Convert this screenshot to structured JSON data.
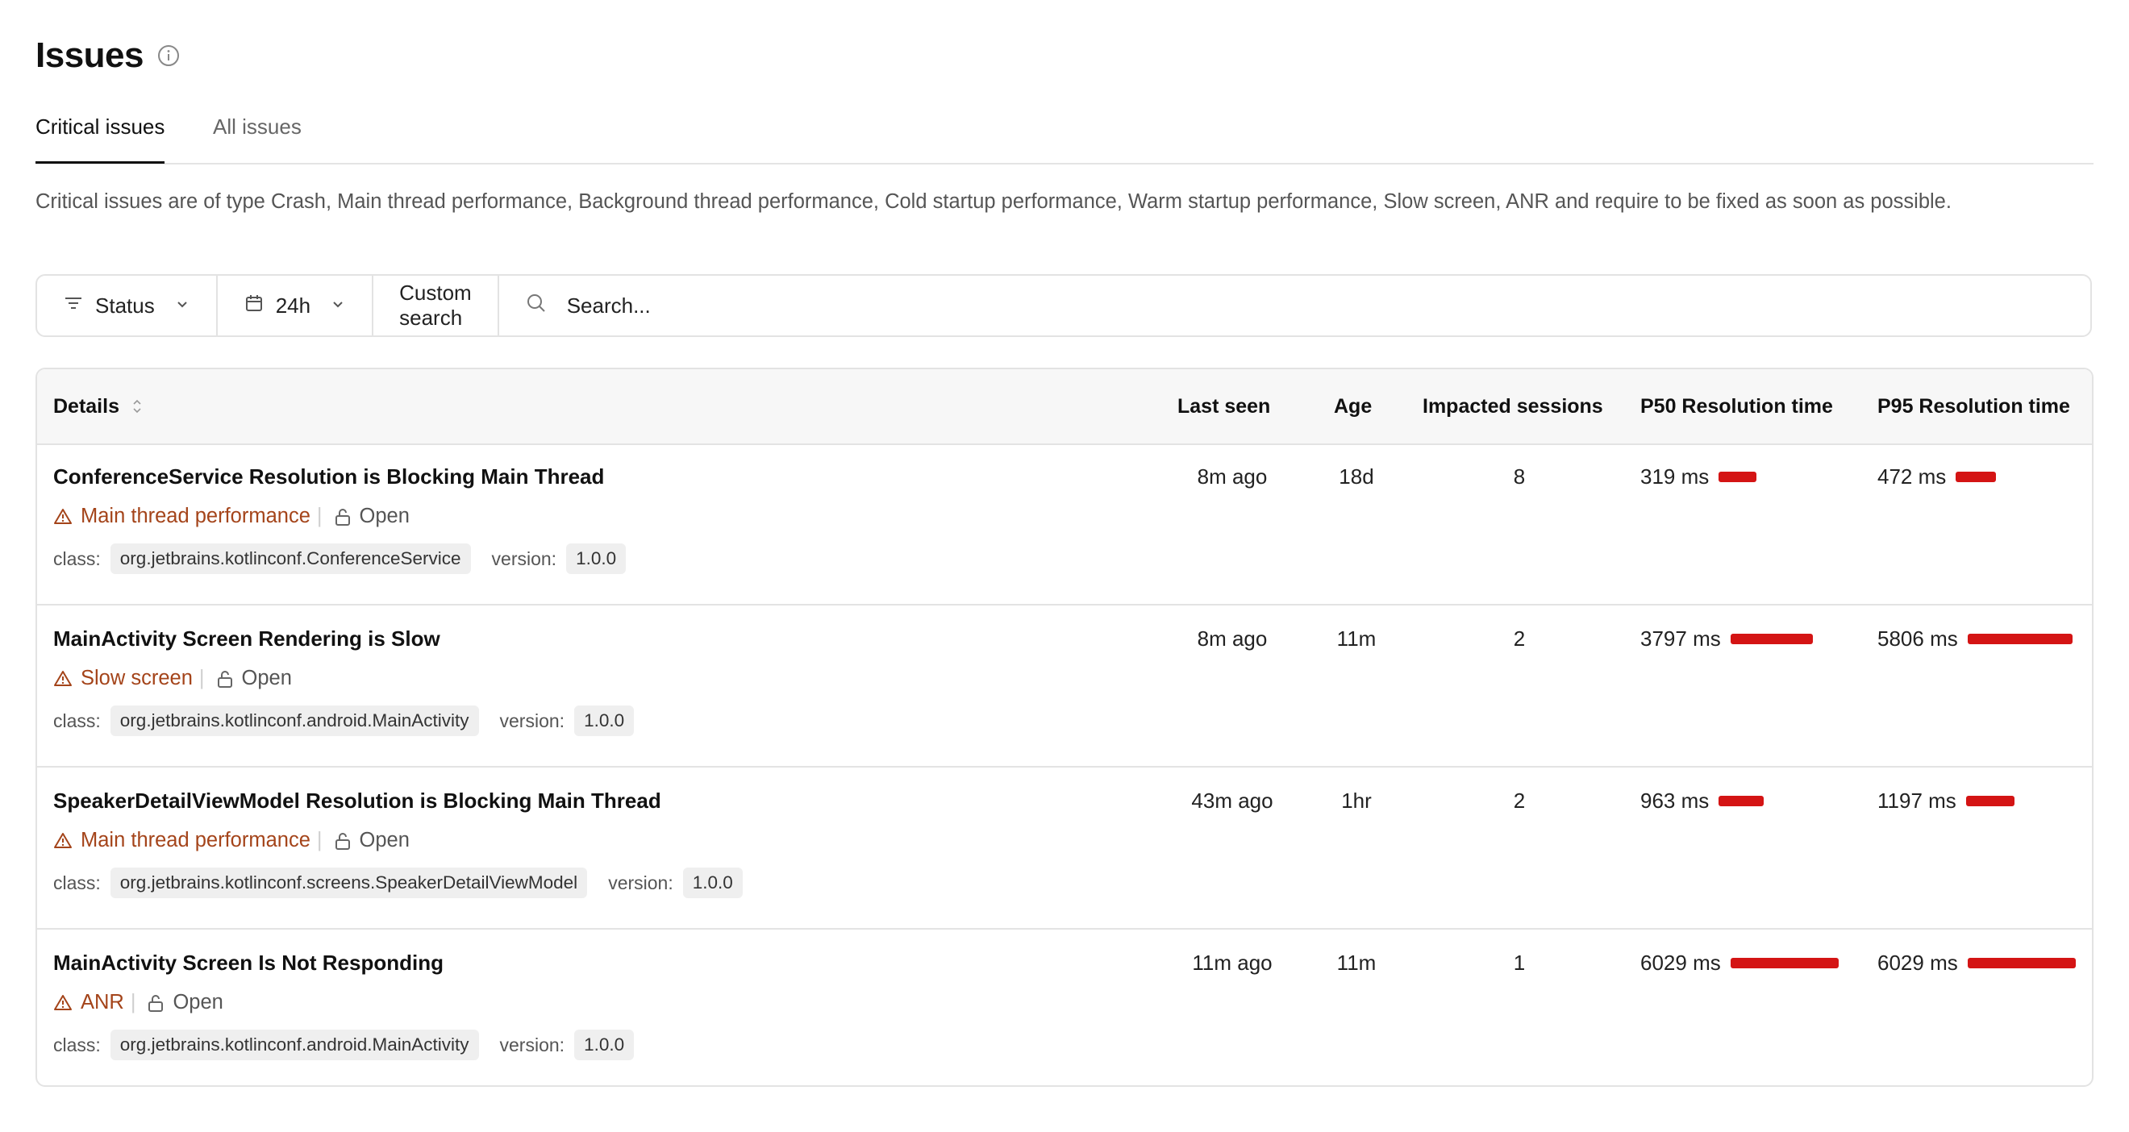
{
  "page": {
    "title": "Issues"
  },
  "tabs": [
    {
      "label": "Critical issues",
      "active": true
    },
    {
      "label": "All issues",
      "active": false
    }
  ],
  "description": "Critical issues are of type Crash, Main thread performance, Background thread performance, Cold startup performance, Warm startup performance, Slow screen, ANR and require to be fixed as soon as possible.",
  "filters": {
    "status_label": "Status",
    "time_label": "24h",
    "custom_search_label": "Custom search",
    "search_placeholder": "Search..."
  },
  "table": {
    "columns": {
      "details": "Details",
      "last_seen": "Last seen",
      "age": "Age",
      "impacted_sessions": "Impacted sessions",
      "p50": "P50 Resolution time",
      "p95": "P95 Resolution time"
    },
    "class_label": "class:",
    "version_label": "version:",
    "rows": [
      {
        "title": "ConferenceService Resolution is Blocking Main Thread",
        "type": "Main thread performance",
        "status": "Open",
        "class": "org.jetbrains.kotlinconf.ConferenceService",
        "version": "1.0.0",
        "last_seen": "8m ago",
        "age": "18d",
        "sessions": "8",
        "p50": "319 ms",
        "p95": "472 ms",
        "p50_fraction": 0.35,
        "p95_fraction": 0.37
      },
      {
        "title": "MainActivity Screen Rendering is Slow",
        "type": "Slow screen",
        "status": "Open",
        "class": "org.jetbrains.kotlinconf.android.MainActivity",
        "version": "1.0.0",
        "last_seen": "8m ago",
        "age": "11m",
        "sessions": "2",
        "p50": "3797 ms",
        "p95": "5806 ms",
        "p50_fraction": 0.76,
        "p95_fraction": 0.97
      },
      {
        "title": "SpeakerDetailViewModel Resolution is Blocking Main Thread",
        "type": "Main thread performance",
        "status": "Open",
        "class": "org.jetbrains.kotlinconf.screens.SpeakerDetailViewModel",
        "version": "1.0.0",
        "last_seen": "43m ago",
        "age": "1hr",
        "sessions": "2",
        "p50": "963 ms",
        "p95": "1197 ms",
        "p50_fraction": 0.42,
        "p95_fraction": 0.45
      },
      {
        "title": "MainActivity Screen Is Not Responding",
        "type": "ANR",
        "status": "Open",
        "class": "org.jetbrains.kotlinconf.android.MainActivity",
        "version": "1.0.0",
        "last_seen": "11m ago",
        "age": "11m",
        "sessions": "1",
        "p50": "6029 ms",
        "p95": "6029 ms",
        "p50_fraction": 1.0,
        "p95_fraction": 1.0
      }
    ]
  },
  "icons": {
    "info": "info-icon",
    "filter": "filter-lines-icon",
    "calendar": "calendar-icon",
    "chevron": "chevron-down-icon",
    "search": "search-icon",
    "sort": "sort-icon",
    "warning": "warning-triangle-icon",
    "lock": "lock-open-icon"
  },
  "colors": {
    "accent_warning": "#a4441a",
    "bar": "#d41414"
  }
}
